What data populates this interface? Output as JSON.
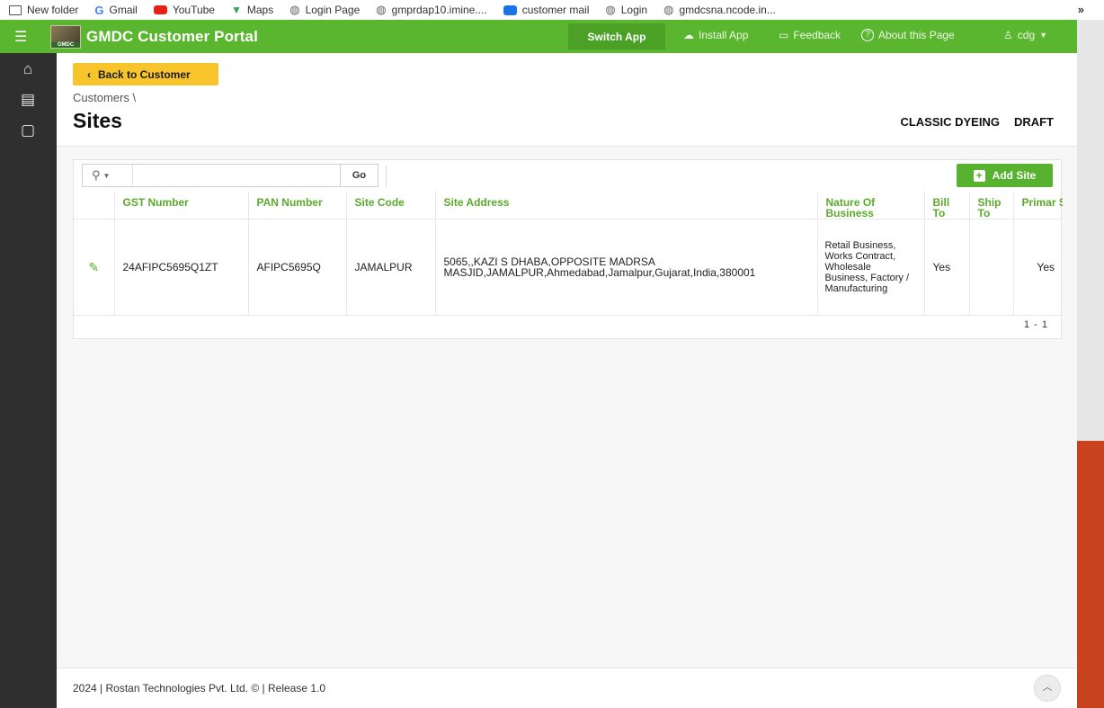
{
  "bookmarks": [
    {
      "label": "New folder",
      "icon": "folder-icon",
      "color": "#555555"
    },
    {
      "label": "Gmail",
      "icon": "google-icon",
      "color": "#4285f4"
    },
    {
      "label": "YouTube",
      "icon": "youtube-icon",
      "color": "#e62117"
    },
    {
      "label": "Maps",
      "icon": "maps-icon",
      "color": "#34a853"
    },
    {
      "label": "Login Page",
      "icon": "globe-icon",
      "color": "#666666"
    },
    {
      "label": "gmprdap10.imine....",
      "icon": "globe-icon",
      "color": "#666666"
    },
    {
      "label": "customer mail",
      "icon": "mail-icon",
      "color": "#1a73e8"
    },
    {
      "label": "Login",
      "icon": "globe-icon",
      "color": "#666666"
    },
    {
      "label": "gmdcsna.ncode.in...",
      "icon": "globe-icon",
      "color": "#666666"
    }
  ],
  "bookmarks_more": "»",
  "shell": {
    "title": "GMDC Customer Portal",
    "switch_app": "Switch App",
    "install_app": "Install App",
    "feedback": "Feedback",
    "about": "About this Page",
    "user": "cdg",
    "accent": "#5ab52f"
  },
  "header": {
    "back_label": "Back to Customer",
    "breadcrumb": "Customers \\",
    "title": "Sites",
    "customer_name": "CLASSIC DYEING",
    "status": "DRAFT"
  },
  "toolbar": {
    "search_value": "",
    "go_label": "Go",
    "add_label": "Add Site"
  },
  "table": {
    "columns": [
      "GST Number",
      "PAN Number",
      "Site Code",
      "Site Address",
      "Nature Of Business",
      "Bill To",
      "Ship To",
      "Primar Site"
    ],
    "rows": [
      {
        "gst": "24AFIPC5695Q1ZT",
        "pan": "AFIPC5695Q",
        "site_code": "JAMALPUR",
        "address": "5065,,KAZI S DHABA,OPPOSITE MADRSA MASJID,JAMALPUR,Ahmedabad,Jamalpur,Gujarat,India,380001",
        "nature": "Retail Business, Works Contract, Wholesale Business, Factory / Manufacturing",
        "bill_to": "Yes",
        "ship_to": "",
        "primary": "Yes"
      }
    ],
    "pager": "1 - 1"
  },
  "footer": {
    "text": "2024 | Rostan Technologies Pvt. Ltd. © | Release 1.0"
  }
}
